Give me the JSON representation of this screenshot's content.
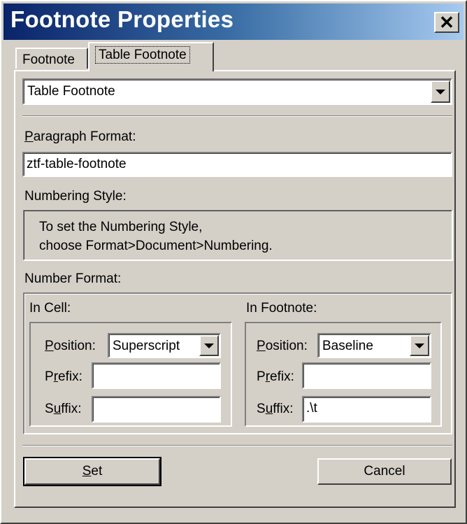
{
  "window": {
    "title": "Footnote Properties",
    "close_glyph": "✕"
  },
  "tabs": [
    {
      "label": "Footnote"
    },
    {
      "label": "Table Footnote"
    }
  ],
  "type_combo": {
    "value": "Table Footnote"
  },
  "paragraph_format": {
    "label_mnemonic": "P",
    "label_rest": "aragraph Format:",
    "value": "ztf-table-footnote"
  },
  "numbering_style": {
    "label": "Numbering Style:",
    "line1": "To set the Numbering Style,",
    "line2": "choose Format>Document>Numbering."
  },
  "number_format": {
    "label": "Number Format:",
    "in_cell": {
      "label": "In Cell:",
      "position_mn": "P",
      "position_rest": "osition:",
      "position_value": "Superscript",
      "prefix_a": "P",
      "prefix_mn": "r",
      "prefix_b": "efix:",
      "prefix_value": "",
      "suffix_a": "S",
      "suffix_mn": "u",
      "suffix_b": "ffix:",
      "suffix_value": ""
    },
    "in_footnote": {
      "label": "In Footnote:",
      "position_mn": "P",
      "position_rest": "osition:",
      "position_value": "Baseline",
      "prefix_a": "P",
      "prefix_mn": "r",
      "prefix_b": "efix:",
      "prefix_value": "",
      "suffix_a": "S",
      "suffix_mn": "u",
      "suffix_b": "ffix:",
      "suffix_value": ".\\t"
    }
  },
  "buttons": {
    "set_mn": "S",
    "set_rest": "et",
    "cancel": "Cancel"
  }
}
